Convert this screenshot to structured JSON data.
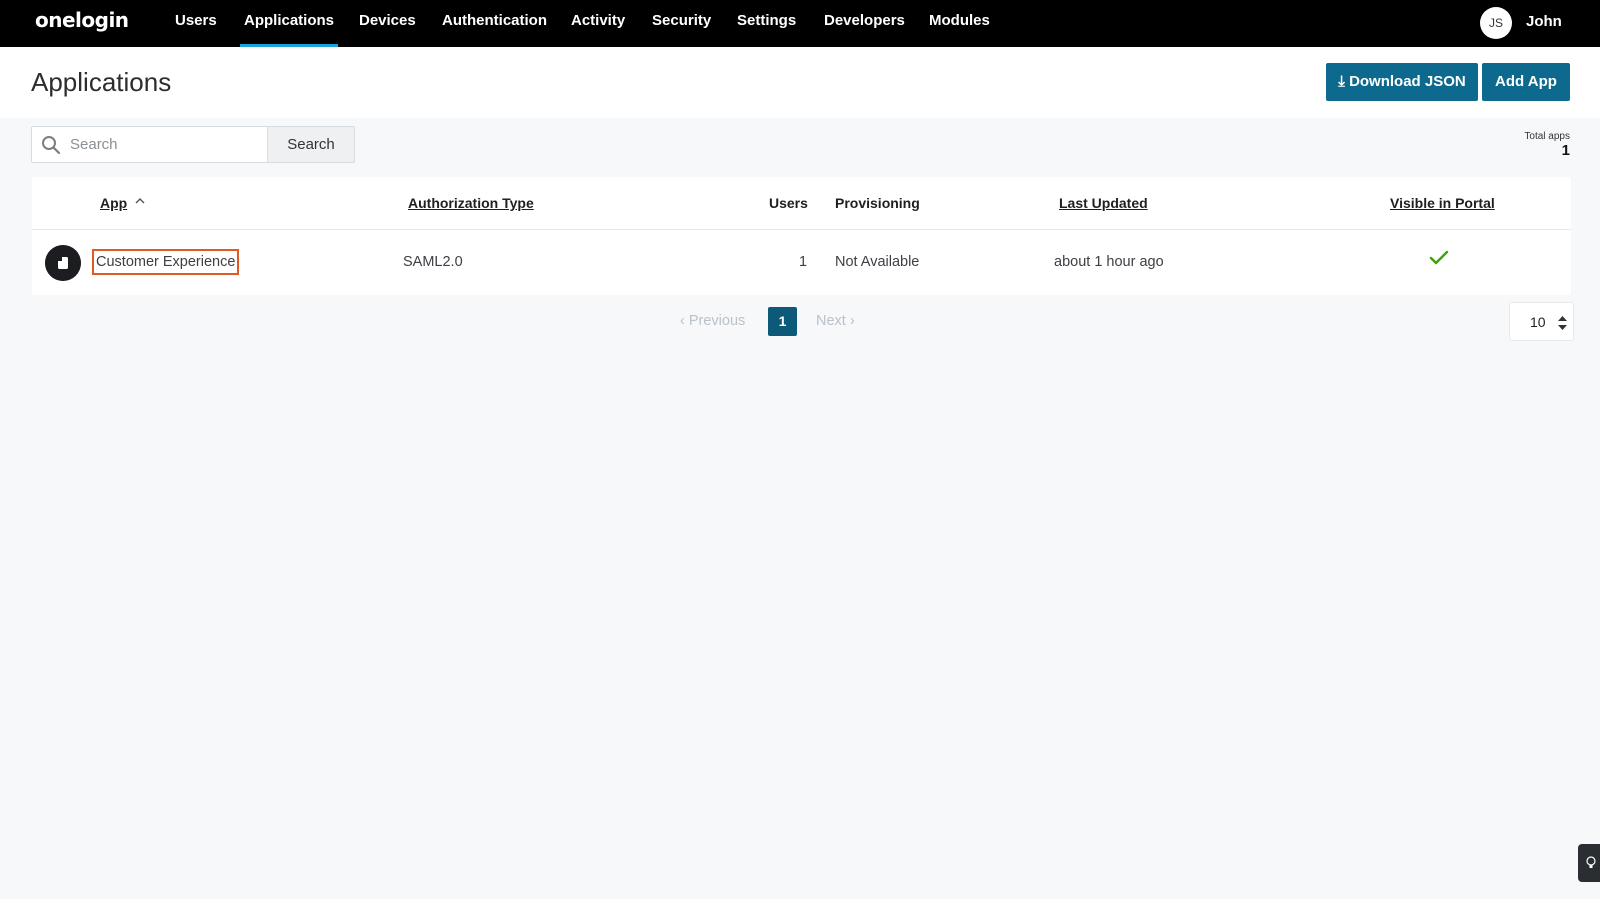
{
  "nav": {
    "logo": "onelogin",
    "items": [
      {
        "label": "Users",
        "active": false
      },
      {
        "label": "Applications",
        "active": true
      },
      {
        "label": "Devices",
        "active": false
      },
      {
        "label": "Authentication",
        "active": false
      },
      {
        "label": "Activity",
        "active": false
      },
      {
        "label": "Security",
        "active": false
      },
      {
        "label": "Settings",
        "active": false
      },
      {
        "label": "Developers",
        "active": false
      },
      {
        "label": "Modules",
        "active": false
      }
    ],
    "avatar_initials": "JS",
    "user_name": "John"
  },
  "header": {
    "title": "Applications",
    "download_json_label": "Download JSON",
    "download_icon": "download-icon",
    "add_app_label": "Add App"
  },
  "search": {
    "placeholder": "Search",
    "value": "",
    "button_label": "Search"
  },
  "totals": {
    "label": "Total apps",
    "value": "1"
  },
  "table": {
    "columns": [
      {
        "label": "App",
        "sortable": true,
        "sorted": "ascending"
      },
      {
        "label": "Authorization Type",
        "sortable": true
      },
      {
        "label": "Users",
        "sortable": false
      },
      {
        "label": "Provisioning",
        "sortable": false
      },
      {
        "label": "Last Updated",
        "sortable": true
      },
      {
        "label": "Visible in Portal",
        "sortable": true
      }
    ],
    "rows": [
      {
        "icon": "onelogin-app-icon",
        "app": "Customer Experience",
        "auth_type": "SAML2.0",
        "users": "1",
        "provisioning": "Not Available",
        "last_updated": "about 1 hour ago",
        "visible_in_portal": true
      }
    ]
  },
  "pagination": {
    "previous_label": "Previous",
    "current_page": "1",
    "next_label": "Next",
    "page_size": "10"
  },
  "colors": {
    "nav_bg": "#000000",
    "accent": "#0d6a8e",
    "active_tab_underline": "#1aa3d9",
    "selection_outline": "#e05a22",
    "check": "#3aa500"
  }
}
